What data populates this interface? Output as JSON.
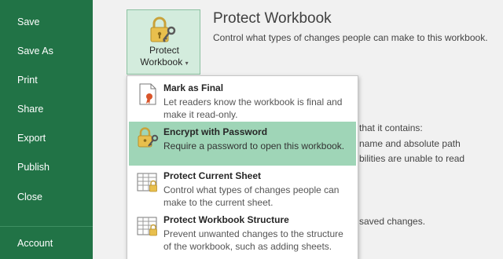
{
  "sidebar": {
    "items": [
      {
        "label": "Save"
      },
      {
        "label": "Save As"
      },
      {
        "label": "Print"
      },
      {
        "label": "Share"
      },
      {
        "label": "Export"
      },
      {
        "label": "Publish"
      },
      {
        "label": "Close"
      },
      {
        "label": "Account"
      }
    ]
  },
  "protect_button": {
    "line1": "Protect",
    "line2": "Workbook",
    "caret": "▾"
  },
  "header": {
    "title": "Protect Workbook",
    "description": "Control what types of changes people can make to this workbook."
  },
  "background_text": {
    "line1": "that it contains:",
    "line2": "name and absolute path",
    "line3": "bilities are unable to read",
    "line4": "saved changes."
  },
  "menu": {
    "items": [
      {
        "title": "Mark as Final",
        "description": "Let readers know the workbook is final and make it read-only.",
        "icon": "ribbon-document-icon"
      },
      {
        "title": "Encrypt with Password",
        "description": "Require a password to open this workbook.",
        "icon": "lock-key-icon"
      },
      {
        "title": "Protect Current Sheet",
        "description": "Control what types of changes people can make to the current sheet.",
        "icon": "sheet-lock-icon"
      },
      {
        "title": "Protect Workbook Structure",
        "description": "Prevent unwanted changes to the structure of the workbook, such as adding sheets.",
        "icon": "workbook-lock-icon"
      }
    ]
  },
  "colors": {
    "accent": "#217346",
    "highlight": "#9fd5b7",
    "button_bg": "#d3ecdd"
  }
}
